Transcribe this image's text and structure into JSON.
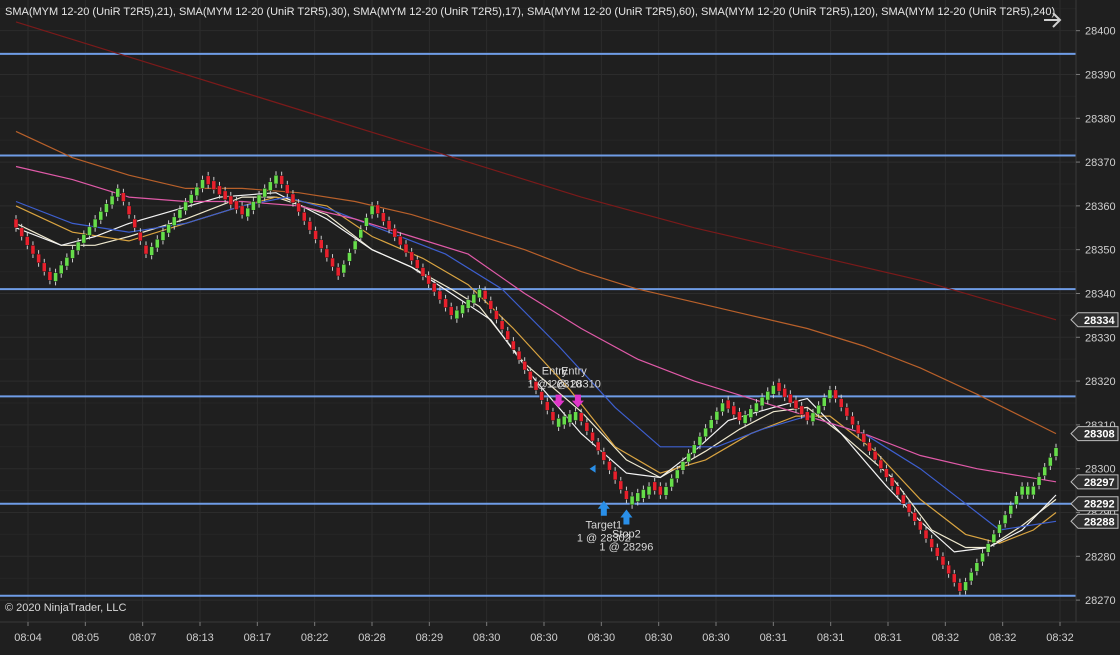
{
  "legend": "SMA(MYM 12-20 (UniR T2R5),21), SMA(MYM 12-20 (UniR T2R5),30), SMA(MYM 12-20 (UniR T2R5),17), SMA(MYM 12-20 (UniR T2R5),60), SMA(MYM 12-20 (UniR T2R5),120), SMA(MYM 12-20 (UniR T2R5),240)",
  "copyright": "© 2020 NinjaTrader, LLC",
  "icons": {
    "expand": "arrow-right-icon"
  },
  "colors": {
    "background": "#1f1f1f",
    "grid": "#2c2c2c",
    "candle_up": "#66dd4a",
    "candle_down": "#e8202c",
    "level_line": "#6f9ce6",
    "price_tag_bg": "#2e2e2e",
    "sma_21": "#f0ead0",
    "sma_30": "#d9a441",
    "sma_17": "#f4f4f4",
    "sma_60": "#3d5fcf",
    "sma_120": "#e05aa8",
    "sma_240": "#b8602a",
    "sma_extra": "#7a1a1a",
    "entry_marker": "#e034c8",
    "exit_marker": "#2a8fe8"
  },
  "chart_data": {
    "type": "candlestick",
    "ylim": [
      28265,
      28407
    ],
    "y_ticks": [
      28270,
      28280,
      28290,
      28300,
      28310,
      28320,
      28330,
      28340,
      28350,
      28360,
      28370,
      28380,
      28390,
      28400
    ],
    "x_labels": [
      "08:04",
      "08:05",
      "08:07",
      "08:13",
      "08:17",
      "08:22",
      "08:28",
      "08:29",
      "08:30",
      "08:30",
      "08:30",
      "08:30",
      "08:30",
      "08:31",
      "08:31",
      "08:31",
      "08:32",
      "08:32",
      "08:32"
    ],
    "horizontal_levels": [
      28394.7,
      28371.5,
      28341.0,
      28316.5,
      28292.0,
      28271.0
    ],
    "price_tags": [
      28334,
      28308,
      28297,
      28292,
      28288
    ],
    "bar_count": 185,
    "path": [
      {
        "i": 0,
        "p": 28355
      },
      {
        "i": 6,
        "p": 28343
      },
      {
        "i": 18,
        "p": 28364
      },
      {
        "i": 23,
        "p": 28349
      },
      {
        "i": 33,
        "p": 28366
      },
      {
        "i": 40,
        "p": 28358
      },
      {
        "i": 46,
        "p": 28367
      },
      {
        "i": 57,
        "p": 28344
      },
      {
        "i": 63,
        "p": 28360
      },
      {
        "i": 77,
        "p": 28335
      },
      {
        "i": 82,
        "p": 28341
      },
      {
        "i": 95,
        "p": 28311
      },
      {
        "i": 99,
        "p": 28313
      },
      {
        "i": 108,
        "p": 28293
      },
      {
        "i": 112,
        "p": 28296
      },
      {
        "i": 114,
        "p": 28294
      },
      {
        "i": 125,
        "p": 28315
      },
      {
        "i": 128,
        "p": 28311
      },
      {
        "i": 134,
        "p": 28319
      },
      {
        "i": 140,
        "p": 28311
      },
      {
        "i": 144,
        "p": 28318
      },
      {
        "i": 167,
        "p": 28272
      },
      {
        "i": 178,
        "p": 28296
      },
      {
        "i": 180,
        "p": 28296
      },
      {
        "i": 185,
        "p": 28307
      }
    ],
    "series": [
      {
        "name": "SMA(MYM 12-20 (UniR T2R5),21)",
        "color": "#f0ead0",
        "points": [
          [
            0,
            28356
          ],
          [
            8,
            28351
          ],
          [
            14,
            28351
          ],
          [
            20,
            28353
          ],
          [
            30,
            28357
          ],
          [
            40,
            28362
          ],
          [
            46,
            28362
          ],
          [
            55,
            28358
          ],
          [
            63,
            28350
          ],
          [
            70,
            28346
          ],
          [
            77,
            28341
          ],
          [
            82,
            28337
          ],
          [
            90,
            28324
          ],
          [
            100,
            28313
          ],
          [
            108,
            28302
          ],
          [
            114,
            28298
          ],
          [
            122,
            28304
          ],
          [
            128,
            28309
          ],
          [
            134,
            28313
          ],
          [
            140,
            28314
          ],
          [
            146,
            28308
          ],
          [
            155,
            28298
          ],
          [
            162,
            28286
          ],
          [
            168,
            28282
          ],
          [
            172,
            28282
          ],
          [
            178,
            28287
          ],
          [
            184,
            28293
          ]
        ]
      },
      {
        "name": "SMA(MYM 12-20 (UniR T2R5),30)",
        "color": "#d9a441",
        "points": [
          [
            0,
            28360
          ],
          [
            10,
            28354
          ],
          [
            20,
            28352
          ],
          [
            30,
            28356
          ],
          [
            40,
            28360
          ],
          [
            46,
            28362
          ],
          [
            55,
            28360
          ],
          [
            63,
            28353
          ],
          [
            72,
            28348
          ],
          [
            80,
            28342
          ],
          [
            88,
            28332
          ],
          [
            98,
            28318
          ],
          [
            106,
            28305
          ],
          [
            114,
            28299
          ],
          [
            122,
            28302
          ],
          [
            130,
            28308
          ],
          [
            138,
            28312
          ],
          [
            144,
            28312
          ],
          [
            152,
            28304
          ],
          [
            160,
            28293
          ],
          [
            168,
            28285
          ],
          [
            174,
            28283
          ],
          [
            180,
            28286
          ],
          [
            184,
            28290
          ]
        ]
      },
      {
        "name": "SMA(MYM 12-20 (UniR T2R5),17)",
        "color": "#f4f4f4",
        "points": [
          [
            0,
            28355
          ],
          [
            8,
            28351
          ],
          [
            14,
            28353
          ],
          [
            20,
            28356
          ],
          [
            28,
            28359
          ],
          [
            36,
            28362
          ],
          [
            46,
            28363
          ],
          [
            55,
            28357
          ],
          [
            63,
            28350
          ],
          [
            70,
            28346
          ],
          [
            77,
            28340
          ],
          [
            84,
            28334
          ],
          [
            92,
            28320
          ],
          [
            100,
            28308
          ],
          [
            108,
            28299
          ],
          [
            114,
            28298
          ],
          [
            120,
            28304
          ],
          [
            126,
            28311
          ],
          [
            134,
            28314
          ],
          [
            140,
            28316
          ],
          [
            146,
            28308
          ],
          [
            154,
            28296
          ],
          [
            160,
            28288
          ],
          [
            166,
            28281
          ],
          [
            172,
            28282
          ],
          [
            178,
            28286
          ],
          [
            184,
            28294
          ]
        ]
      },
      {
        "name": "SMA(MYM 12-20 (UniR T2R5),60)",
        "color": "#3d5fcf",
        "points": [
          [
            0,
            28361
          ],
          [
            10,
            28356
          ],
          [
            20,
            28354
          ],
          [
            30,
            28356
          ],
          [
            40,
            28360
          ],
          [
            48,
            28362
          ],
          [
            56,
            28359
          ],
          [
            66,
            28354
          ],
          [
            76,
            28349
          ],
          [
            86,
            28341
          ],
          [
            96,
            28328
          ],
          [
            106,
            28314
          ],
          [
            114,
            28305
          ],
          [
            124,
            28305
          ],
          [
            132,
            28309
          ],
          [
            140,
            28312
          ],
          [
            150,
            28308
          ],
          [
            160,
            28300
          ],
          [
            168,
            28292
          ],
          [
            174,
            28286
          ],
          [
            184,
            28288
          ]
        ]
      },
      {
        "name": "SMA(MYM 12-20 (UniR T2R5),120)",
        "color": "#e05aa8",
        "points": [
          [
            0,
            28369
          ],
          [
            10,
            28366
          ],
          [
            20,
            28362
          ],
          [
            30,
            28361
          ],
          [
            40,
            28361
          ],
          [
            50,
            28360
          ],
          [
            60,
            28357
          ],
          [
            70,
            28353
          ],
          [
            80,
            28349
          ],
          [
            90,
            28340
          ],
          [
            100,
            28332
          ],
          [
            110,
            28325
          ],
          [
            120,
            28320
          ],
          [
            130,
            28316
          ],
          [
            140,
            28312
          ],
          [
            150,
            28308
          ],
          [
            160,
            28303
          ],
          [
            170,
            28300
          ],
          [
            184,
            28297
          ]
        ]
      },
      {
        "name": "SMA(MYM 12-20 (UniR T2R5),240)",
        "color": "#b8602a",
        "points": [
          [
            0,
            28377
          ],
          [
            10,
            28371
          ],
          [
            20,
            28367
          ],
          [
            30,
            28364
          ],
          [
            40,
            28364
          ],
          [
            50,
            28363
          ],
          [
            60,
            28361
          ],
          [
            70,
            28358
          ],
          [
            80,
            28354
          ],
          [
            90,
            28350
          ],
          [
            100,
            28345
          ],
          [
            110,
            28341
          ],
          [
            120,
            28338
          ],
          [
            130,
            28335
          ],
          [
            140,
            28332
          ],
          [
            150,
            28328
          ],
          [
            160,
            28323
          ],
          [
            170,
            28317
          ],
          [
            184,
            28308
          ]
        ]
      },
      {
        "name": "",
        "color": "#7a1a1a",
        "points": [
          [
            0,
            28402
          ],
          [
            20,
            28394
          ],
          [
            40,
            28386
          ],
          [
            60,
            28378
          ],
          [
            80,
            28370
          ],
          [
            100,
            28362
          ],
          [
            120,
            28355
          ],
          [
            140,
            28349
          ],
          [
            160,
            28343
          ],
          [
            184,
            28334
          ]
        ]
      }
    ],
    "annotations": [
      {
        "kind": "entry",
        "label": "Entry",
        "qty": "1 @ 28310",
        "bar": 96,
        "price": 28316,
        "dx": 0
      },
      {
        "kind": "entry",
        "label": "Entry",
        "qty": "1 @ 28310",
        "bar": 98,
        "price": 28316,
        "dx": 8
      },
      {
        "kind": "exit",
        "label": "Target1",
        "qty": "1 @ 28302",
        "bar": 104,
        "price": 28292,
        "dx": 0
      },
      {
        "kind": "exit",
        "label": "Stop2",
        "qty": "1 @ 28296",
        "bar": 108,
        "price": 28290,
        "dx": 0
      }
    ]
  }
}
